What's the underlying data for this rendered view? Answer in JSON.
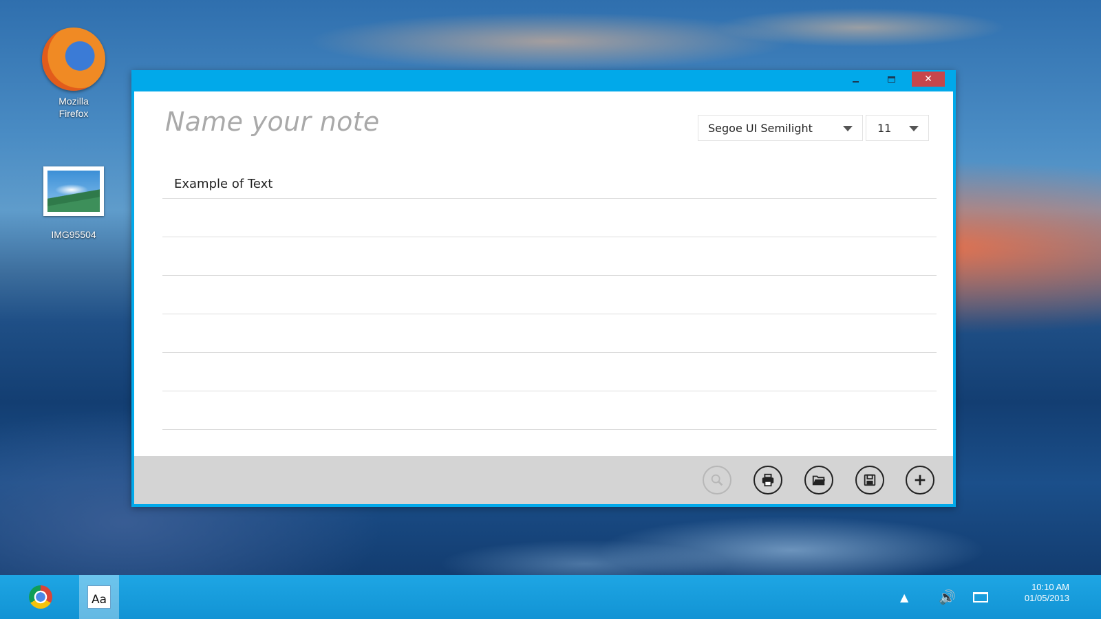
{
  "desktop": {
    "icons": [
      {
        "label_line1": "Mozilla",
        "label_line2": "Firefox",
        "icon": "firefox-icon"
      },
      {
        "label": "IMG95504",
        "icon": "image-icon"
      }
    ]
  },
  "window": {
    "controls": {
      "minimize": "minimize-icon",
      "maximize": "maximize-icon",
      "close": "✕"
    },
    "note_title_placeholder": "Name your note",
    "font_family": "Segoe UI Semilight",
    "font_size": "11",
    "lines": [
      "Example of Text",
      "",
      "",
      "",
      "",
      "",
      ""
    ],
    "toolbar": [
      "search-icon",
      "print-icon",
      "open-folder-icon",
      "save-icon",
      "add-icon"
    ]
  },
  "taskbar": {
    "apps": [
      "chrome-icon",
      "notes-app-icon"
    ],
    "notes_app_glyph": "Aa",
    "tray_up": "▲",
    "volume": "🔊",
    "time": "10:10 AM",
    "date": "01/05/2013"
  },
  "colors": {
    "titlebar": "#01a9ea",
    "close": "#c7464b",
    "toolbar_bg": "#d4d4d4",
    "taskbar": "#1ea6e4"
  }
}
